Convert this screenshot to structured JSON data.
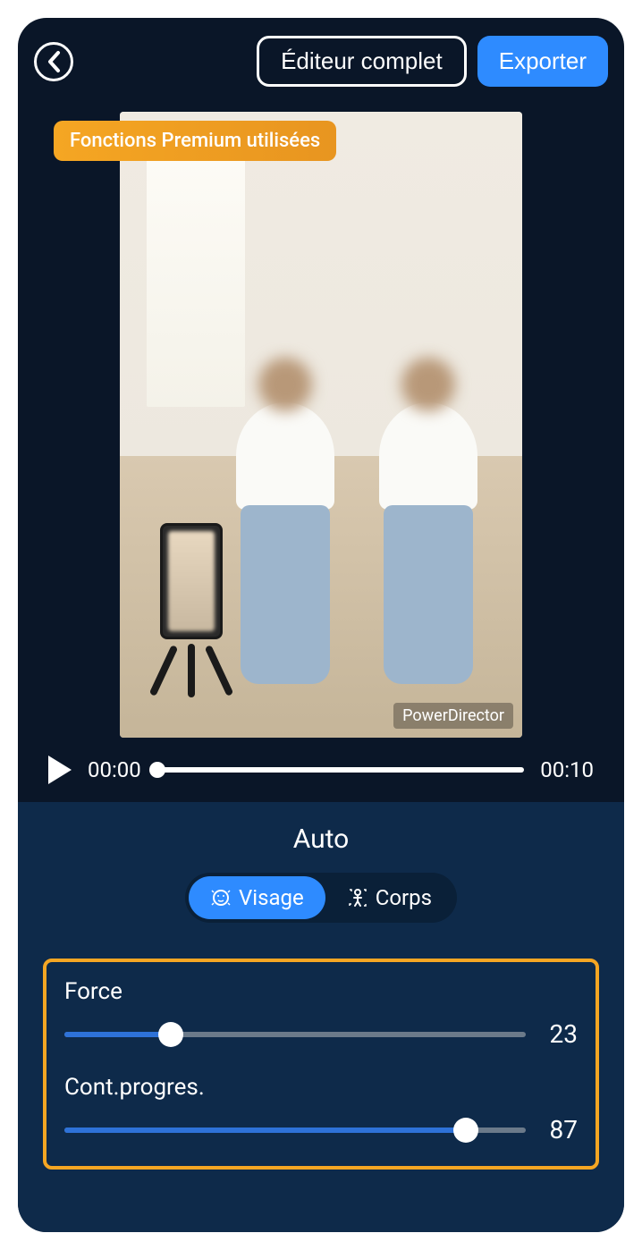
{
  "header": {
    "editor_label": "Éditeur complet",
    "export_label": "Exporter"
  },
  "preview": {
    "premium_badge": "Fonctions Premium utilisées",
    "watermark": "PowerDirector"
  },
  "playback": {
    "current_time": "00:00",
    "total_time": "00:10",
    "progress_percent": 0
  },
  "controls": {
    "mode_title": "Auto",
    "segments": [
      {
        "label": "Visage",
        "active": true
      },
      {
        "label": "Corps",
        "active": false
      }
    ],
    "sliders": [
      {
        "label": "Force",
        "value": 23,
        "percent": 23
      },
      {
        "label": "Cont.progres.",
        "value": 87,
        "percent": 87
      }
    ]
  },
  "colors": {
    "accent": "#2e8bff",
    "highlight": "#f5a623",
    "panel": "#0e2a4a",
    "background": "#0a1628"
  }
}
